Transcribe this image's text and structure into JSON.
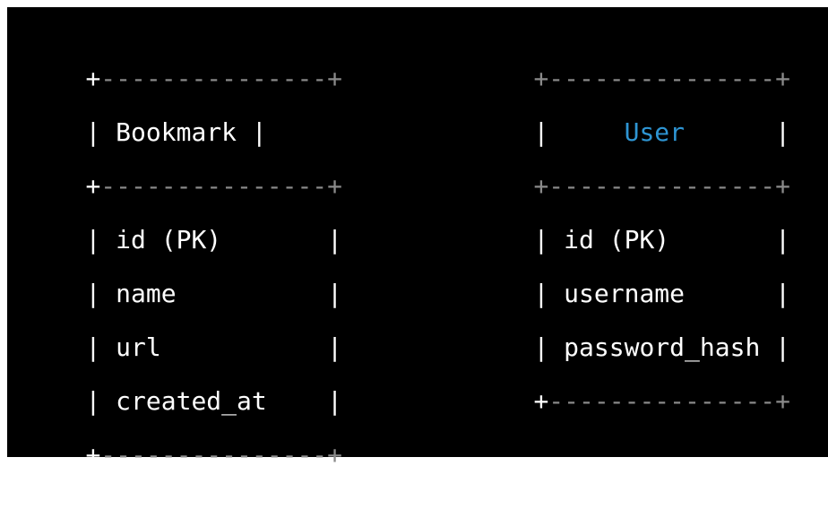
{
  "entities": [
    {
      "title": "Bookmark",
      "fields": [
        "id (PK)",
        "name",
        "url",
        "created_at"
      ],
      "border_top": "+---------------+",
      "border_bottom": "+---------------+"
    },
    {
      "title": "User",
      "fields": [
        "id (PK)",
        "username",
        "password_hash"
      ],
      "border_top": "+---------------+",
      "border_bottom": "+---------------+"
    }
  ],
  "colors": {
    "background": "#000000",
    "text": "#ffffff",
    "dash": "#8a8a8a",
    "title_user": "#2e95d3"
  }
}
